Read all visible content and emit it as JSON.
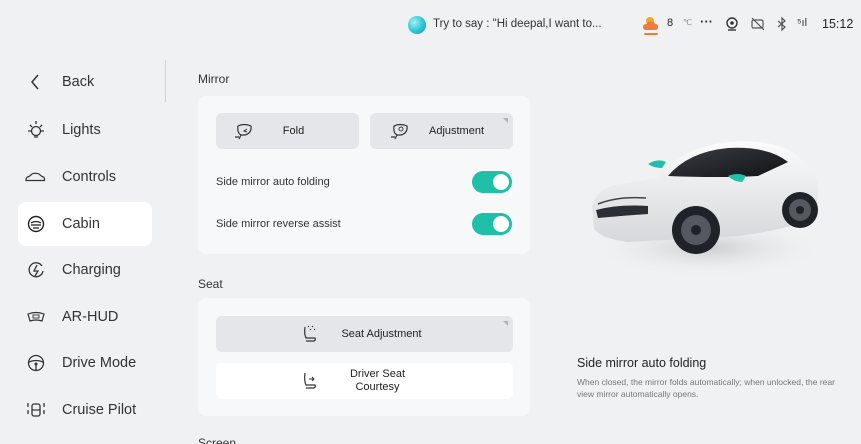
{
  "status_bar": {
    "voice_prompt": "Try to say : \"Hi deepal,I want to...",
    "temperature": "8",
    "temperature_unit": "℃",
    "more": "···",
    "signal": "⁵ıl",
    "time": "15:12"
  },
  "sidebar": {
    "items": [
      {
        "label": "Back",
        "icon": "back-chevron-icon"
      },
      {
        "label": "Lights",
        "icon": "light-icon"
      },
      {
        "label": "Controls",
        "icon": "car-icon"
      },
      {
        "label": "Cabin",
        "icon": "cabin-icon",
        "active": true
      },
      {
        "label": "Charging",
        "icon": "charging-icon"
      },
      {
        "label": "AR-HUD",
        "icon": "hud-icon"
      },
      {
        "label": "Drive Mode",
        "icon": "steering-wheel-icon"
      },
      {
        "label": "Cruise Pilot",
        "icon": "cruise-pilot-icon"
      }
    ]
  },
  "mirror": {
    "title": "Mirror",
    "fold_label": "Fold",
    "adjustment_label": "Adjustment",
    "auto_folding_label": "Side mirror auto folding",
    "auto_folding_on": true,
    "reverse_assist_label": "Side mirror reverse assist",
    "reverse_assist_on": true
  },
  "seat": {
    "title": "Seat",
    "adjustment_label": "Seat Adjustment",
    "courtesy_label_1": "Driver Seat",
    "courtesy_label_2": "Courtesy"
  },
  "screen": {
    "title": "Screen"
  },
  "info": {
    "title": "Side mirror auto folding",
    "description": "When closed, the mirror folds automatically; when unlocked, the rear view mirror automatically opens."
  },
  "colors": {
    "accent": "#1fbfa8",
    "background": "#f0f1f3"
  }
}
